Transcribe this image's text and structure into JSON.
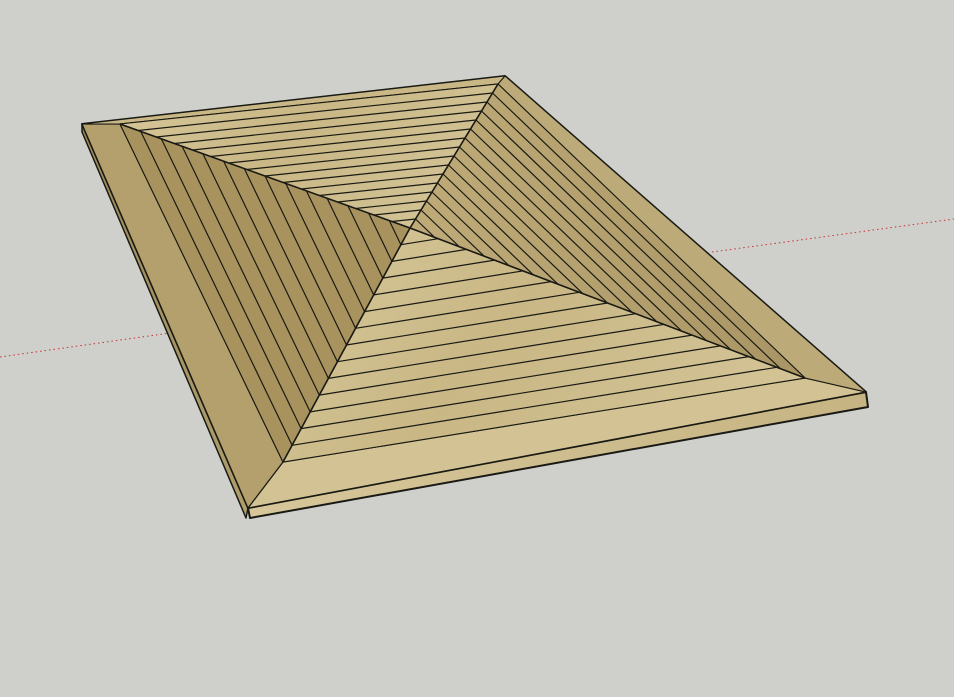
{
  "viewport": {
    "background_color": "#cfd0cc",
    "axis_color": "#c83232"
  },
  "model": {
    "wood_light": "#cfbf8e",
    "wood_mid": "#b8a472",
    "wood_dark": "#857449",
    "edge_color": "#1a1a14"
  }
}
